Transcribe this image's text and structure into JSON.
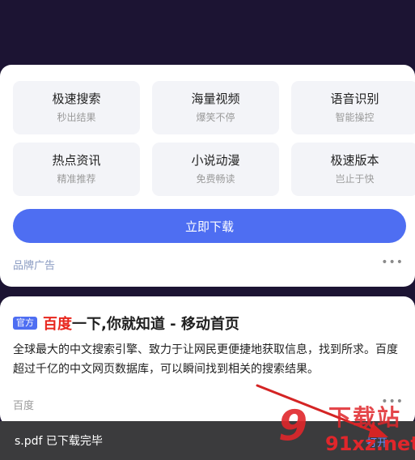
{
  "ad_card": {
    "features": [
      {
        "title": "极速搜索",
        "sub": "秒出结果"
      },
      {
        "title": "海量视频",
        "sub": "爆笑不停"
      },
      {
        "title": "语音识别",
        "sub": "智能操控"
      },
      {
        "title": "热点资讯",
        "sub": "精准推荐"
      },
      {
        "title": "小说动漫",
        "sub": "免费畅读"
      },
      {
        "title": "极速版本",
        "sub": "岂止于快"
      }
    ],
    "download_label": "立即下载",
    "ad_label": "品牌广告",
    "more": "•••"
  },
  "result": {
    "badge": "官方",
    "title_highlight": "百度",
    "title_rest": "一下,你就知道 - 移动首页",
    "description": "全球最大的中文搜索引擎、致力于让网民更便捷地获取信息，找到所求。百度超过千亿的中文网页数据库，可以瞬间找到相关的搜索结果。",
    "source": "百度",
    "more": "•••"
  },
  "toast": {
    "message": "s.pdf 已下载完毕",
    "action": "打开"
  },
  "watermark": {
    "logo": "9",
    "top_text": "下载站",
    "domain": "91xz.net"
  },
  "colors": {
    "accent": "#4e6ef2",
    "highlight": "#e8261d",
    "arrow": "#d42424"
  }
}
